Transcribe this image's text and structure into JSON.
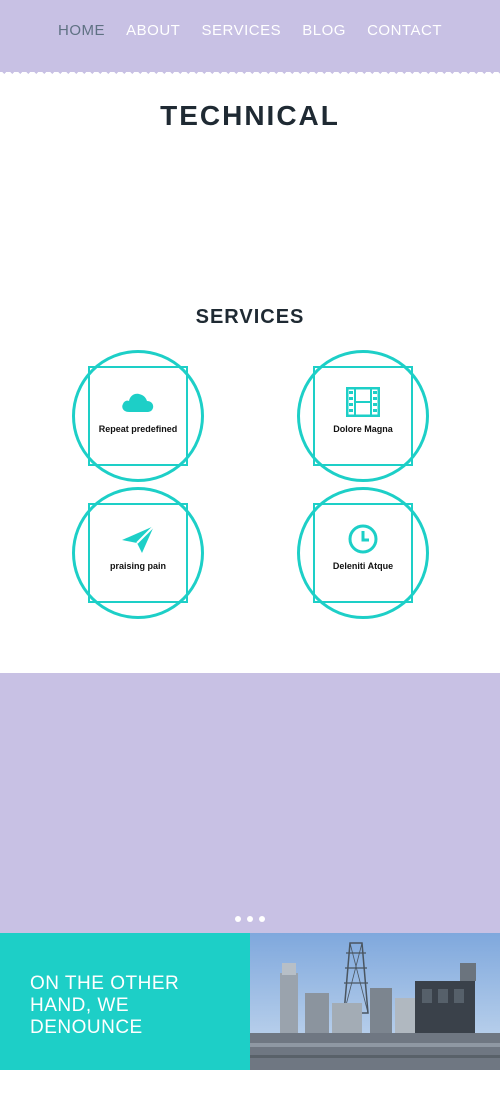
{
  "nav": {
    "items": [
      "HOME",
      "ABOUT",
      "SERVICES",
      "BLOG",
      "CONTACT"
    ],
    "active_index": 0
  },
  "hero": {
    "title": "TECHNICAL"
  },
  "services": {
    "title": "SERVICES",
    "items": [
      {
        "label": "Repeat predefined",
        "icon": "cloud-icon"
      },
      {
        "label": "Dolore Magna",
        "icon": "film-icon"
      },
      {
        "label": "praising pain",
        "icon": "paper-plane-icon"
      },
      {
        "label": "Deleniti Atque",
        "icon": "clock-icon"
      }
    ]
  },
  "slider": {
    "dots": 3,
    "active_dot": 0
  },
  "feature": {
    "title": "ON THE OTHER HAND, WE DENOUNCE"
  },
  "colors": {
    "accent": "#1dcfc7",
    "lavender": "#c8c1e4",
    "nav_active": "#5f7183"
  }
}
